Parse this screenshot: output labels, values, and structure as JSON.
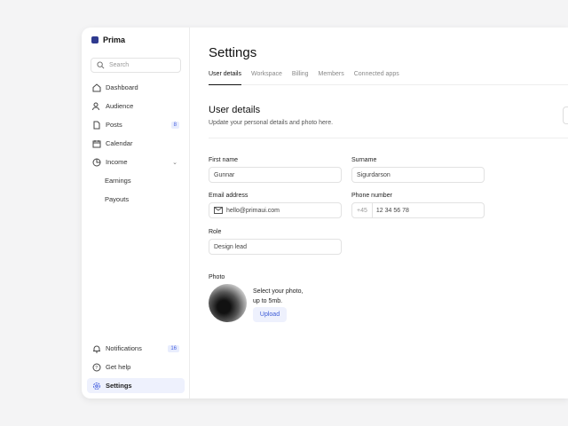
{
  "app": {
    "name": "Prima"
  },
  "sidebar": {
    "search_placeholder": "Search",
    "items": [
      {
        "label": "Dashboard"
      },
      {
        "label": "Audience"
      },
      {
        "label": "Posts",
        "badge": "8"
      },
      {
        "label": "Calendar"
      },
      {
        "label": "Income"
      },
      {
        "label": "Earnings"
      },
      {
        "label": "Payouts"
      }
    ],
    "bottom": [
      {
        "label": "Notifications",
        "badge": "16"
      },
      {
        "label": "Get help"
      },
      {
        "label": "Settings"
      }
    ]
  },
  "page": {
    "title": "Settings",
    "tabs": [
      "User details",
      "Workspace",
      "Billing",
      "Members",
      "Connected apps"
    ],
    "section_title": "User details",
    "section_desc": "Update your personal details and photo here.",
    "fields": {
      "first_name": {
        "label": "First name",
        "value": "Gunnar"
      },
      "surname": {
        "label": "Surname",
        "value": "Sigurdarson"
      },
      "email": {
        "label": "Email address",
        "value": "hello@primaui.com"
      },
      "phone": {
        "label": "Phone number",
        "prefix": "+45",
        "value": "12 34 56 78"
      },
      "role": {
        "label": "Role",
        "value": "Design lead"
      }
    },
    "photo": {
      "label": "Photo",
      "line1": "Select your photo,",
      "line2": "up to 5mb.",
      "upload": "Upload"
    }
  }
}
